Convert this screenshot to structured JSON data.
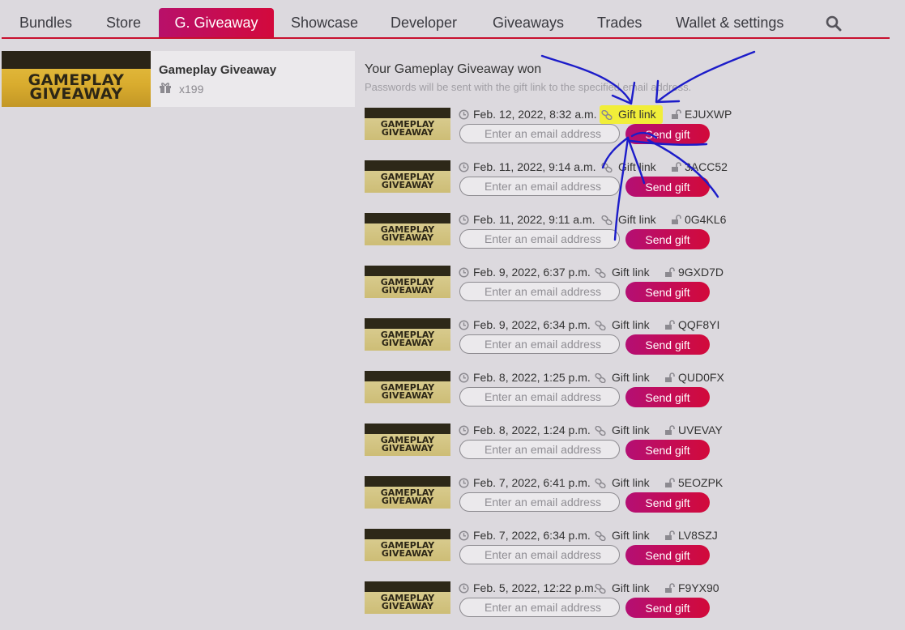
{
  "nav": {
    "items": [
      {
        "label": "Bundles"
      },
      {
        "label": "Store"
      },
      {
        "label": "G. Giveaway"
      },
      {
        "label": "Showcase"
      },
      {
        "label": "Developer"
      },
      {
        "label": "Giveaways"
      },
      {
        "label": "Trades"
      },
      {
        "label": "Wallet & settings"
      }
    ],
    "active_index": 2
  },
  "product": {
    "banner_line1": "GAMEPLAY",
    "banner_line2": "GIVEAWAY",
    "title": "Gameplay Giveaway",
    "count": "x199"
  },
  "won": {
    "title": "Your Gameplay Giveaway won",
    "subtitle": "Passwords will be sent with the gift link to the specified email address."
  },
  "labels": {
    "gift_link": "Gift link",
    "email_placeholder": "Enter an email address",
    "send_gift": "Send gift",
    "thumb_line1": "GAMEPLAY",
    "thumb_line2": "GIVEAWAY"
  },
  "rows": [
    {
      "date": "Feb. 12, 2022, 8:32 a.m.",
      "password": "EJUXWP"
    },
    {
      "date": "Feb. 11, 2022, 9:14 a.m.",
      "password": "3ACC52"
    },
    {
      "date": "Feb. 11, 2022, 9:11 a.m.",
      "password": "0G4KL6"
    },
    {
      "date": "Feb. 9, 2022, 6:37 p.m.",
      "password": "9GXD7D"
    },
    {
      "date": "Feb. 9, 2022, 6:34 p.m.",
      "password": "QQF8YI"
    },
    {
      "date": "Feb. 8, 2022, 1:25 p.m.",
      "password": "QUD0FX"
    },
    {
      "date": "Feb. 8, 2022, 1:24 p.m.",
      "password": "UVEVAY"
    },
    {
      "date": "Feb. 7, 2022, 6:41 p.m.",
      "password": "5EOZPK"
    },
    {
      "date": "Feb. 7, 2022, 6:34 p.m.",
      "password": "LV8SZJ"
    },
    {
      "date": "Feb. 5, 2022, 12:22 p.m.",
      "password": "F9YX90"
    }
  ],
  "colors": {
    "accent": "#d20a3a",
    "accent_secondary": "#b40f74",
    "annotation_ink": "#1c1cc9",
    "highlight": "#f4f11c"
  }
}
